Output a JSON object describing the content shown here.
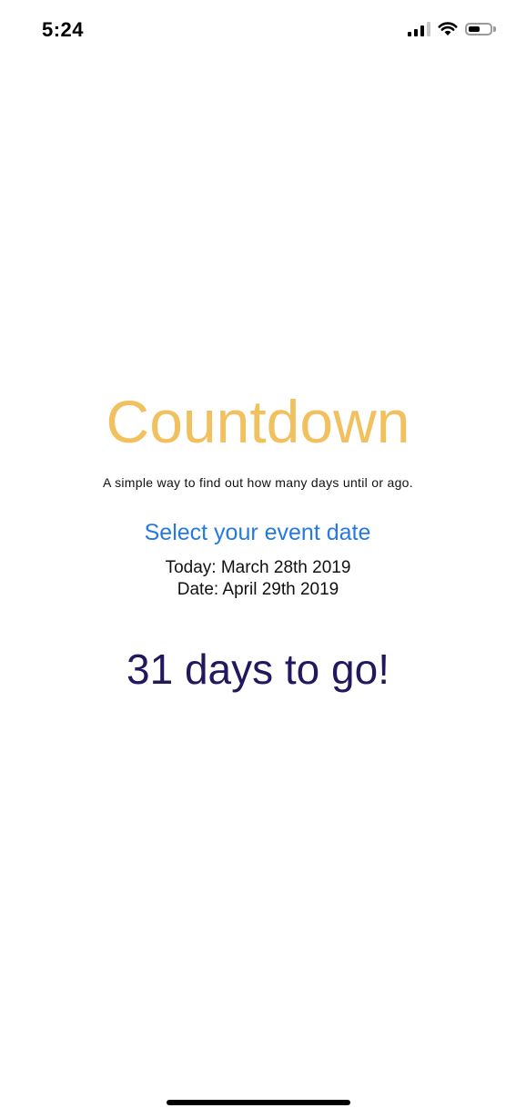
{
  "status_bar": {
    "time": "5:24",
    "icons": [
      "cellular-signal-icon",
      "wifi-icon",
      "battery-icon"
    ],
    "battery_level": 0.6
  },
  "app": {
    "title": "Countdown",
    "subtitle": "A simple way to find out how many days until or ago.",
    "select_date_label": "Select your event date",
    "today_text": "Today: March 28th 2019",
    "date_text": "Date: April 29th 2019",
    "result_text": "31 days to go!"
  },
  "colors": {
    "title": "#f2c15f",
    "link": "#2479e2",
    "result": "#22185e"
  }
}
